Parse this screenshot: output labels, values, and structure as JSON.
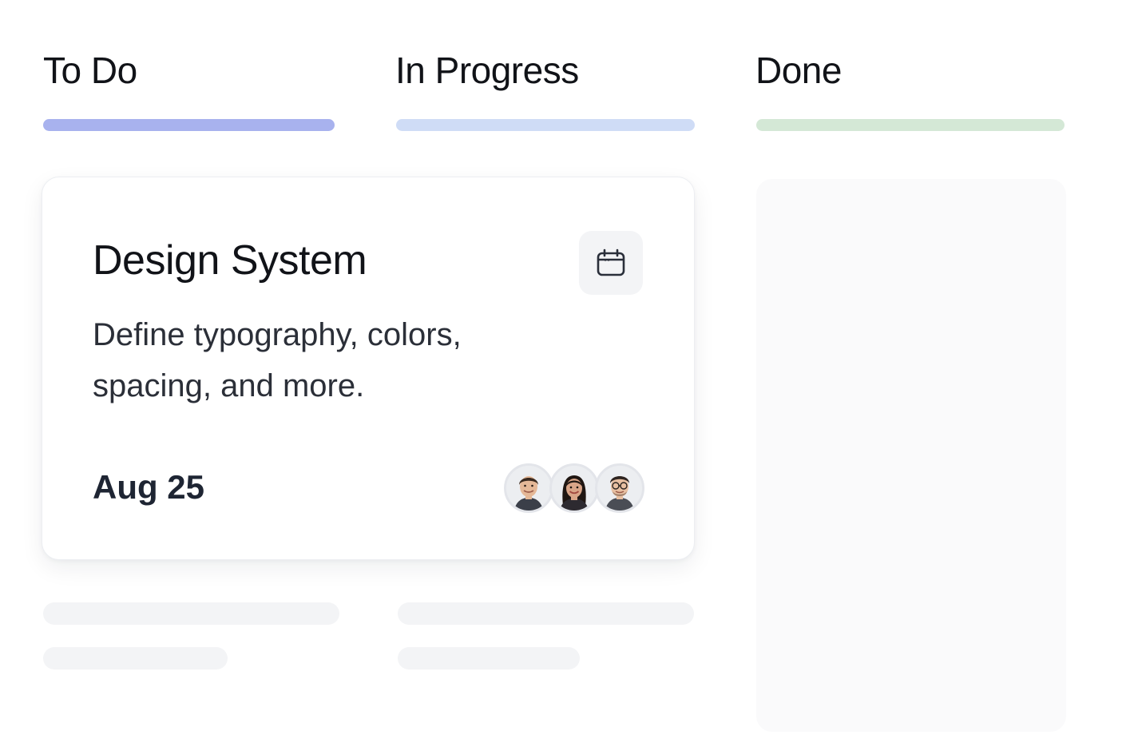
{
  "columns": [
    {
      "title": "To Do",
      "bar_color": "#a8b2ee"
    },
    {
      "title": "In Progress",
      "bar_color": "#cfdcf6"
    },
    {
      "title": "Done",
      "bar_color": "#d4e8d6"
    }
  ],
  "card": {
    "title": "Design System",
    "description": "Define typography, colors, spacing, and more.",
    "date": "Aug 25",
    "icon": "calendar-icon",
    "avatars": [
      {
        "icon": "avatar-man",
        "skin": "#e5b897",
        "hair": "#3a2a20"
      },
      {
        "icon": "avatar-woman",
        "skin": "#d9a588",
        "hair": "#1f1612"
      },
      {
        "icon": "avatar-man-glasses",
        "skin": "#e8c0a2",
        "hair": "#2e2420"
      }
    ]
  }
}
